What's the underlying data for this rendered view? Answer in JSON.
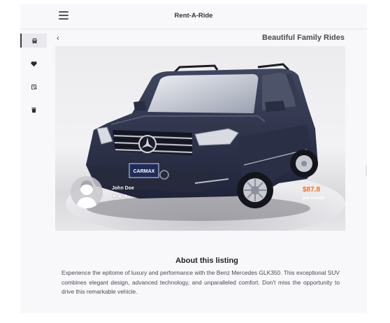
{
  "app": {
    "title": "Rent-A-Ride"
  },
  "sidebar": {
    "items": [
      {
        "name": "vehicles",
        "icon": "car-icon",
        "active": true
      },
      {
        "name": "favorites",
        "icon": "heart-icon",
        "active": false
      },
      {
        "name": "bookings",
        "icon": "calendar-car-icon",
        "active": false
      },
      {
        "name": "trash",
        "icon": "trash-icon",
        "active": false
      }
    ]
  },
  "header": {
    "page_title": "Beautiful Family Rides",
    "back_icon": "chevron-left-icon"
  },
  "listing": {
    "host_name": "John Doe",
    "rating_stars": "★★★",
    "rating_value": 3,
    "price": "$87.8",
    "price_unit": "per month",
    "dealer_plate": "CARMAX",
    "section_title": "About this listing",
    "description": "Experience the epitome of luxury and performance with the Benz Mercedes GLK350. This exceptional SUV combines elegant design, advanced technology, and unparalleled comfort. Don't miss the opportunity to drive this remarkable vehicle."
  },
  "colors": {
    "accent": "#ff6a1f",
    "background": "#f8f7fa",
    "text": "#2d2d33",
    "car_body": "#2b3046"
  }
}
